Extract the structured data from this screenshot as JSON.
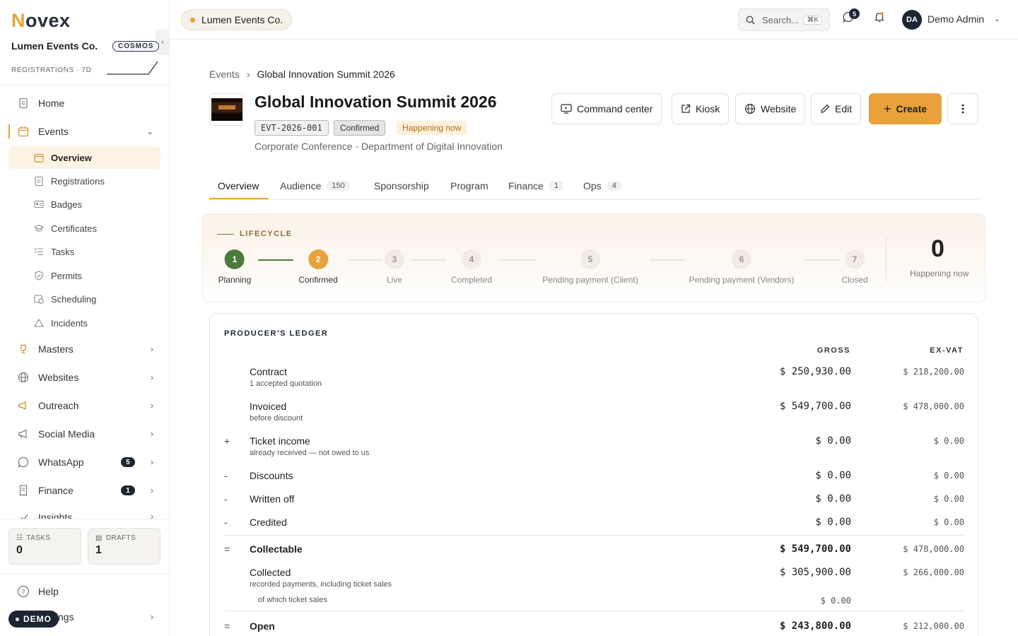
{
  "sidebar": {
    "logo": {
      "n": "N",
      "rest": "ovex"
    },
    "org": "Lumen Events Co.",
    "plan": "COSMOS",
    "regs_label": "REGISTRATIONS · 7D",
    "nav": {
      "home": "Home",
      "events": "Events",
      "events_sub": {
        "overview": "Overview",
        "registrations": "Registrations",
        "badges": "Badges",
        "certificates": "Certificates",
        "tasks": "Tasks",
        "permits": "Permits",
        "scheduling": "Scheduling",
        "incidents": "Incidents"
      },
      "masters": "Masters",
      "websites": "Websites",
      "outreach": "Outreach",
      "social": "Social Media",
      "whatsapp": "WhatsApp",
      "whatsapp_count": "5",
      "finance": "Finance",
      "finance_count": "1",
      "insights": "Insights"
    },
    "cards": {
      "tasks_label": "TASKS",
      "tasks_value": "0",
      "drafts_label": "DRAFTS",
      "drafts_value": "1"
    },
    "help": "Help",
    "settings": "Settings",
    "demo": "DEMO"
  },
  "topbar": {
    "org": "Lumen Events Co.",
    "search_placeholder": "Search...",
    "search_kbd": "⌘K",
    "whatsapp_badge": "5",
    "user_initials": "DA",
    "user_name": "Demo Admin"
  },
  "breadcrumb": {
    "parent": "Events",
    "current": "Global Innovation Summit 2026"
  },
  "event": {
    "title": "Global Innovation Summit 2026",
    "code": "EVT-2026-001",
    "status": "Confirmed",
    "live_status": "Happening now",
    "subtitle": "Corporate Conference · Department of Digital Innovation"
  },
  "actions": {
    "command": "Command center",
    "kiosk": "Kiosk",
    "website": "Website",
    "edit": "Edit",
    "create": "Create"
  },
  "tabs": [
    {
      "label": "Overview",
      "count": ""
    },
    {
      "label": "Audience",
      "count": "150"
    },
    {
      "label": "Sponsorship",
      "count": ""
    },
    {
      "label": "Program",
      "count": ""
    },
    {
      "label": "Finance",
      "count": "1"
    },
    {
      "label": "Ops",
      "count": "4"
    }
  ],
  "lifecycle": {
    "label": "LIFECYCLE",
    "steps": [
      {
        "num": "1",
        "label": "Planning",
        "state": "done"
      },
      {
        "num": "2",
        "label": "Confirmed",
        "state": "current"
      },
      {
        "num": "3",
        "label": "Live",
        "state": "todo"
      },
      {
        "num": "4",
        "label": "Completed",
        "state": "todo"
      },
      {
        "num": "5",
        "label": "Pending payment (Client)",
        "state": "todo"
      },
      {
        "num": "6",
        "label": "Pending payment (Vendors)",
        "state": "todo"
      },
      {
        "num": "7",
        "label": "Closed",
        "state": "todo"
      }
    ],
    "count": "0",
    "count_label": "Happening now"
  },
  "ledger": {
    "title": "PRODUCER'S LEDGER",
    "col_gross": "GROSS",
    "col_exvat": "EX-VAT",
    "rows": [
      {
        "op": "",
        "name": "Contract",
        "desc": "1 accepted quotation",
        "gross": "$ 250,930.00",
        "exvat": "$ 218,200.00"
      },
      {
        "op": "",
        "name": "Invoiced",
        "desc": "before discount",
        "gross": "$ 549,700.00",
        "exvat": "$ 478,000.00"
      },
      {
        "op": "+",
        "name": "Ticket income",
        "desc": "already received — not owed to us",
        "gross": "$ 0.00",
        "exvat": "$ 0.00"
      },
      {
        "op": "-",
        "name": "Discounts",
        "desc": "",
        "gross": "$ 0.00",
        "exvat": "$ 0.00"
      },
      {
        "op": "-",
        "name": "Written off",
        "desc": "",
        "gross": "$ 0.00",
        "exvat": "$ 0.00"
      },
      {
        "op": "-",
        "name": "Credited",
        "desc": "",
        "gross": "$ 0.00",
        "exvat": "$ 0.00"
      },
      {
        "op": "=",
        "name": "Collectable",
        "desc": "",
        "gross": "$ 549,700.00",
        "exvat": "$ 478,000.00"
      },
      {
        "op": "",
        "name": "Collected",
        "desc": "recorded payments, including ticket sales",
        "gross": "$ 305,900.00",
        "exvat": "$ 266,000.00"
      },
      {
        "op": "=",
        "name": "Open",
        "desc": "",
        "gross": "$ 243,800.00",
        "exvat": "$ 212,000.00"
      }
    ],
    "ticket_sales_label": "of which ticket sales",
    "ticket_sales_value": "$ 0.00"
  },
  "colors": {
    "accent": "#e6a23c",
    "done": "#4c7a3c",
    "dark": "#1e2532"
  }
}
